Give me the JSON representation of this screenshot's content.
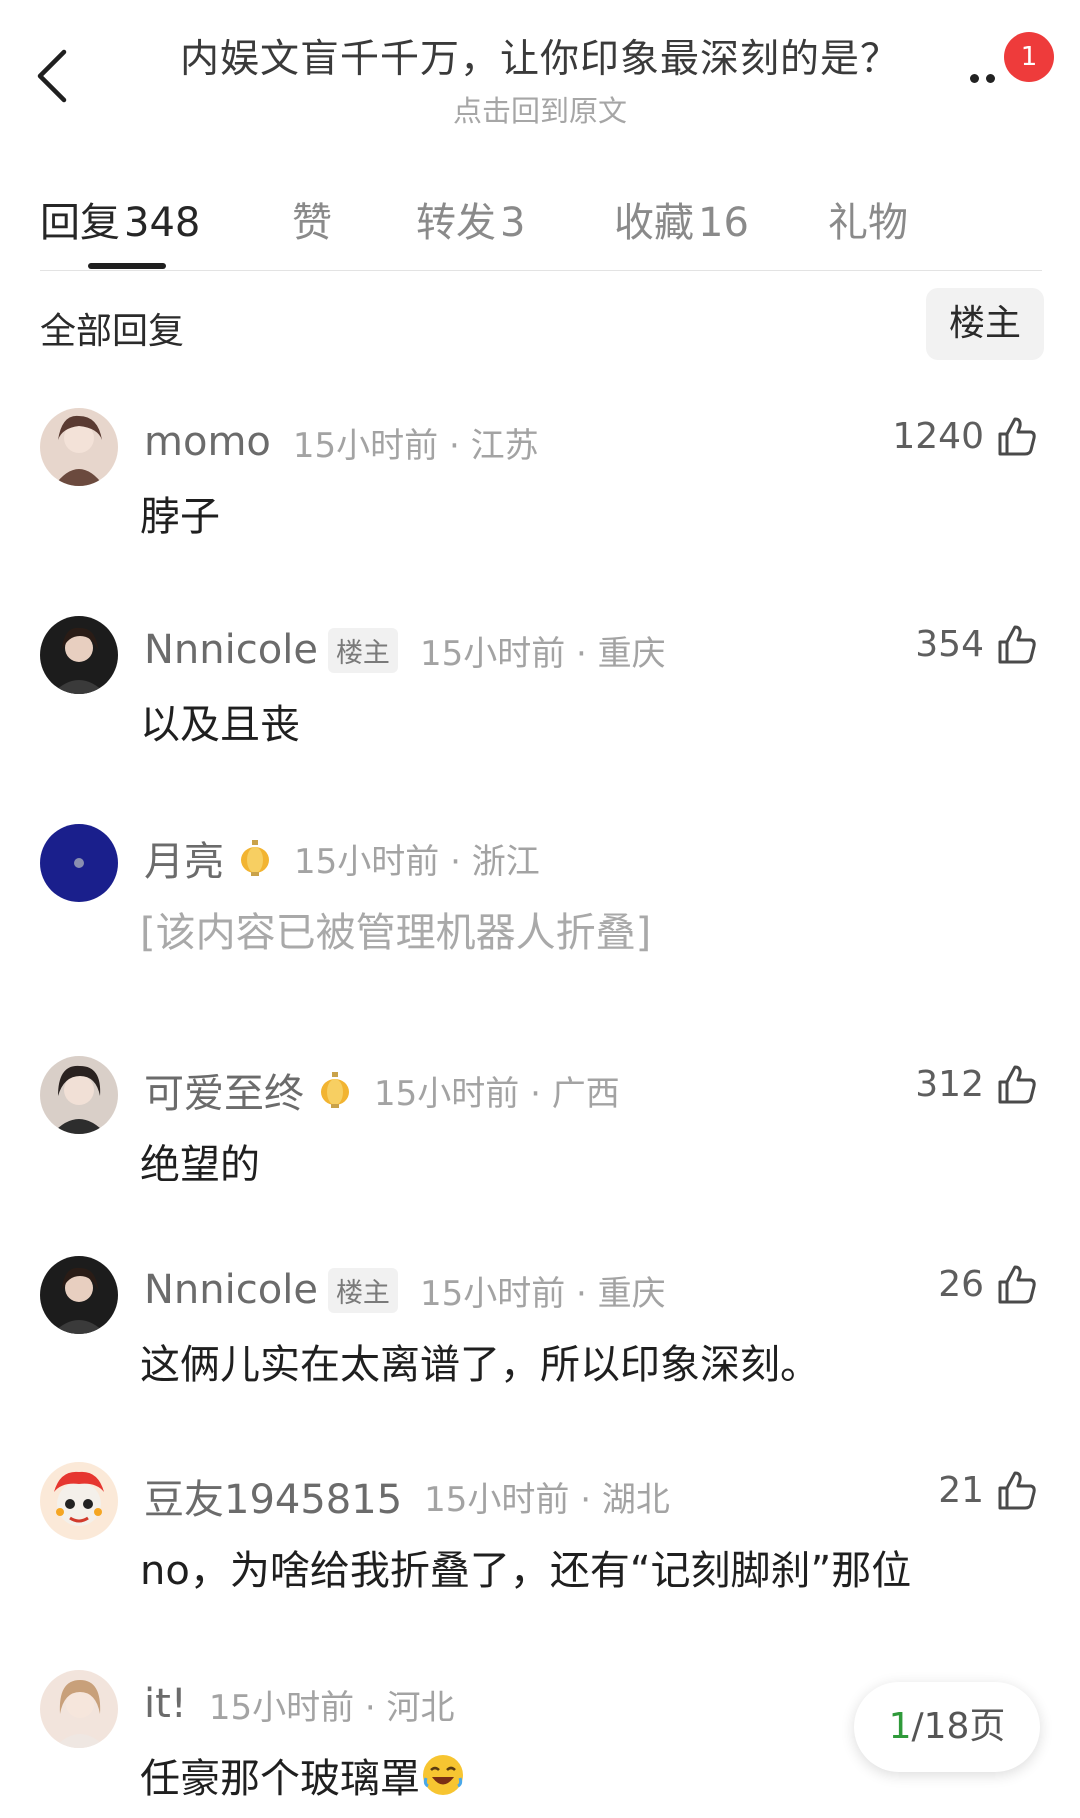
{
  "header": {
    "title": "内娱文盲千千万，让你印象最深刻的是？",
    "subtitle": "点击回到原文",
    "notification_count": "1",
    "back_icon": "chevron-left-icon",
    "more_icon": "more-dots-icon"
  },
  "tabs": [
    {
      "label": "回复",
      "count": "348",
      "active": true
    },
    {
      "label": "赞",
      "count": "",
      "active": false
    },
    {
      "label": "转发",
      "count": "3",
      "active": false
    },
    {
      "label": "收藏",
      "count": "16",
      "active": false
    },
    {
      "label": "礼物",
      "count": "",
      "active": false
    }
  ],
  "filter": {
    "all_replies": "全部回复",
    "host_only": "楼主"
  },
  "comments": [
    {
      "name": "momo",
      "host": false,
      "time": "15小时前",
      "location": "江苏",
      "likes": "1240",
      "content": "脖子"
    },
    {
      "name": "Nnnicole",
      "host": true,
      "host_tag": "楼主",
      "time": "15小时前",
      "location": "重庆",
      "likes": "354",
      "content": "以及且丧"
    },
    {
      "name": "月亮",
      "host": false,
      "time": "15小时前",
      "location": "浙江",
      "likes": "",
      "content": "[该内容已被管理机器人折叠]",
      "folded": true
    },
    {
      "name": "可爱至终",
      "host": false,
      "time": "15小时前",
      "location": "广西",
      "likes": "312",
      "content": "绝望的"
    },
    {
      "name": "Nnnicole",
      "host": true,
      "host_tag": "楼主",
      "time": "15小时前",
      "location": "重庆",
      "likes": "26",
      "content": "这俩儿实在太离谱了，所以印象深刻。"
    },
    {
      "name": "豆友1945815",
      "host": false,
      "time": "15小时前",
      "location": "湖北",
      "likes": "21",
      "content": "no，为啥给我折叠了，还有“记刻脚刹”那位"
    },
    {
      "name": "it!",
      "host": false,
      "time": "15小时前",
      "location": "河北",
      "likes": "",
      "content": "任豪那个玻璃罩"
    }
  ],
  "separator": "·",
  "pagination": {
    "current": "1",
    "total": "/18页"
  },
  "colors": {
    "badge": "#ee3b3b",
    "page_current": "#2f9a3a",
    "muted_text": "#a3a3a3"
  }
}
